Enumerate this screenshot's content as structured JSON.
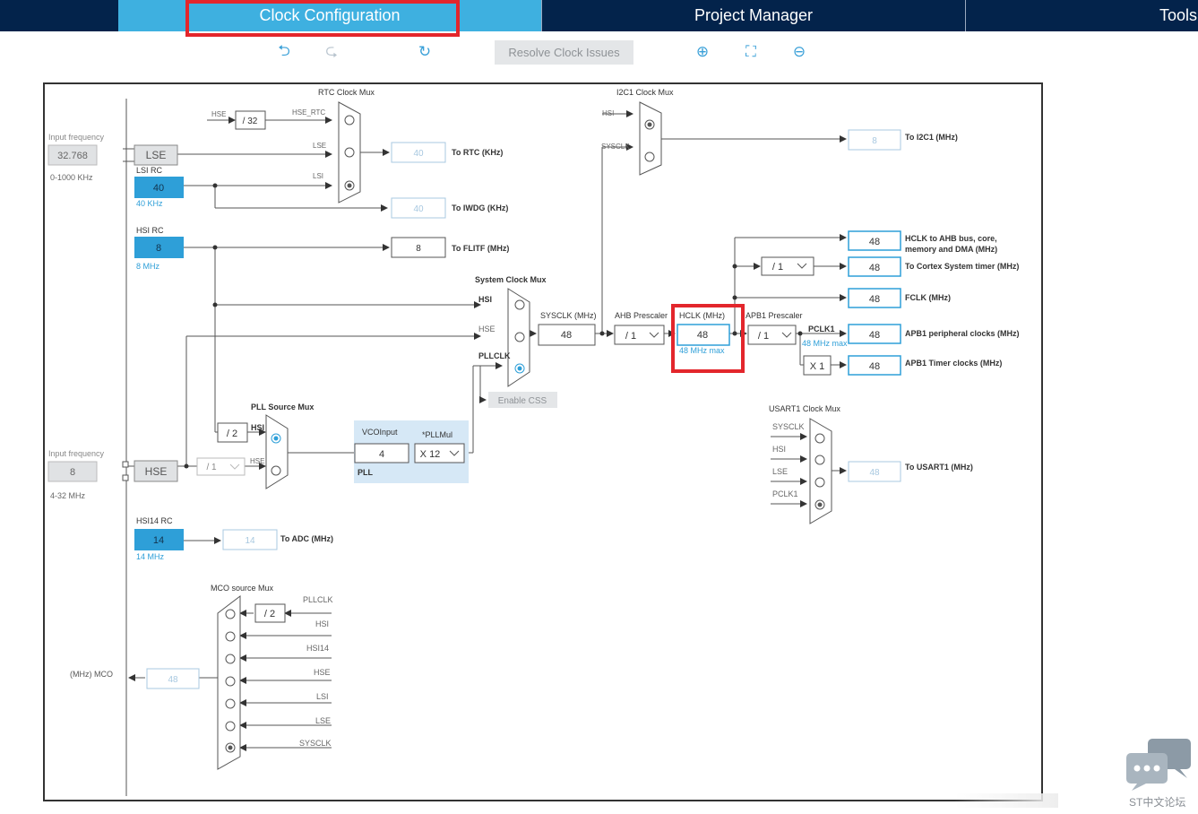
{
  "nav": {
    "tabs": [
      {
        "label": "Clock Configuration",
        "active": true
      },
      {
        "label": "Project Manager",
        "active": false
      },
      {
        "label": "Tools",
        "active": false
      }
    ]
  },
  "toolbar": {
    "undo_icon": "undo-icon",
    "redo_icon": "redo-icon",
    "refresh_icon": "refresh-icon",
    "resolve_label": "Resolve Clock Issues",
    "zoom_in_icon": "zoom-in-icon",
    "fit_icon": "fit-screen-icon",
    "zoom_out_icon": "zoom-out-icon"
  },
  "colors": {
    "nav_bg": "#03234b",
    "active_tab": "#3eb0e0",
    "accent": "#3aa0d8",
    "highlight": "#e3262c",
    "source_fill": "#2e9fd8",
    "pll_box": "#d6e8f6"
  },
  "diagram": {
    "input_freq_label": "Input frequency",
    "lse_input_value": "32.768",
    "lse_range": "0-1000 KHz",
    "lse_label": "LSE",
    "lsi_rc_label": "LSI RC",
    "lsi_rc_value": "40",
    "lsi_rc_sub": "40 KHz",
    "hsi_rc_label": "HSI RC",
    "hsi_rc_value": "8",
    "hsi_rc_sub": "8 MHz",
    "hse_input_value": "8",
    "hse_range": "4-32 MHz",
    "hse_label": "HSE",
    "hsi14_label": "HSI14 RC",
    "hsi14_value": "14",
    "hsi14_sub": "14 MHz",
    "mco_label": "(MHz) MCO",
    "mco_value": "48",
    "rtc_mux": {
      "title": "RTC Clock Mux",
      "hse": "HSE",
      "div": "/ 32",
      "hse_rtc": "HSE_RTC",
      "lse": "LSE",
      "lsi": "LSI"
    },
    "rtc_value": "40",
    "rtc_label": "To RTC (KHz)",
    "iwdg_value": "40",
    "iwdg_label": "To IWDG (KHz)",
    "flitf_value": "8",
    "flitf_label": "To FLITF (MHz)",
    "i2c_mux": {
      "title": "I2C1 Clock Mux",
      "hsi": "HSI",
      "sysclk": "SYSCLK"
    },
    "i2c_value": "8",
    "i2c_label": "To I2C1 (MHz)",
    "sys_mux": {
      "title": "System Clock Mux",
      "hsi": "HSI",
      "hse": "HSE",
      "pllclk": "PLLCLK"
    },
    "enable_css": "Enable CSS",
    "sysclk_label": "SYSCLK (MHz)",
    "sysclk_value": "48",
    "ahb_label": "AHB Prescaler",
    "ahb_value": "/ 1",
    "hclk_label": "HCLK (MHz)",
    "hclk_value": "48",
    "hclk_max": "48 MHz max",
    "apb1_label": "APB1 Prescaler",
    "apb1_value": "/ 1",
    "pclk1_label": "PCLK1",
    "pclk1_max": "48 MHz max",
    "cortex_div": "/ 1",
    "timer_mul": "X 1",
    "outputs": [
      {
        "value": "48",
        "label": "HCLK to AHB bus, core,",
        "label2": "memory and DMA (MHz)"
      },
      {
        "value": "48",
        "label": "To Cortex System timer (MHz)"
      },
      {
        "value": "48",
        "label": "FCLK (MHz)"
      },
      {
        "value": "48",
        "label": "APB1 peripheral clocks (MHz)"
      },
      {
        "value": "48",
        "label": "APB1 Timer clocks (MHz)"
      }
    ],
    "pll_src": {
      "title": "PLL Source Mux",
      "div": "/ 2",
      "hsi": "HSI",
      "hse": "HSE"
    },
    "hse_div": "/ 1",
    "vco_label": "VCOInput",
    "vco_value": "4",
    "pllmul_label": "*PLLMul",
    "pllmul_value": "X 12",
    "pll_label": "PLL",
    "usart_mux": {
      "title": "USART1 Clock Mux",
      "inputs": [
        "SYSCLK",
        "HSI",
        "LSE",
        "PCLK1"
      ]
    },
    "usart_value": "48",
    "usart_label": "To USART1 (MHz)",
    "mco_mux": {
      "title": "MCO source Mux",
      "div": "/ 2",
      "inputs": [
        "PLLCLK",
        "HSI",
        "HSI14",
        "HSE",
        "LSI",
        "LSE",
        "SYSCLK"
      ]
    }
  },
  "footer": {
    "chat_icon": "chat-bubbles-icon",
    "label": "ST中文论坛"
  }
}
